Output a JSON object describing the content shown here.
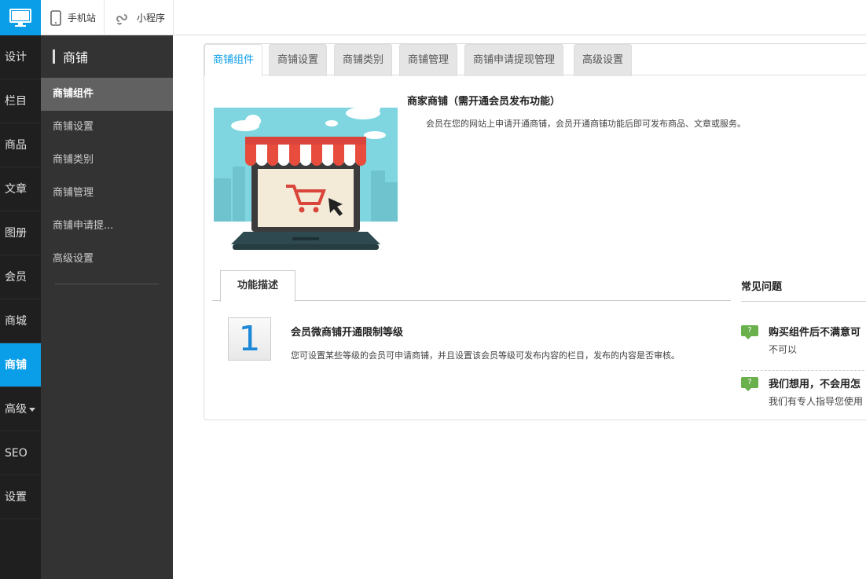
{
  "topbar": {
    "logo_icon": "desktop-monitor-icon",
    "links": [
      {
        "label": "手机站",
        "icon": "mobile-phone-icon"
      },
      {
        "label": "小程序",
        "icon": "mini-program-icon"
      }
    ]
  },
  "rail": {
    "items": [
      {
        "label": "设计"
      },
      {
        "label": "栏目"
      },
      {
        "label": "商品"
      },
      {
        "label": "文章"
      },
      {
        "label": "图册"
      },
      {
        "label": "会员"
      },
      {
        "label": "商城"
      },
      {
        "label": "商铺",
        "active": true
      },
      {
        "label": "高级"
      },
      {
        "label": "SEO"
      },
      {
        "label": "设置"
      }
    ]
  },
  "subnav": {
    "title": "商铺",
    "items": [
      {
        "label": "商铺组件",
        "active": true
      },
      {
        "label": "商铺设置"
      },
      {
        "label": "商铺类别"
      },
      {
        "label": "商铺管理"
      },
      {
        "label": "商铺申请提..."
      },
      {
        "label": "高级设置"
      }
    ]
  },
  "tabs": [
    {
      "label": "商铺组件",
      "active": true
    },
    {
      "label": "商铺设置"
    },
    {
      "label": "商铺类别"
    },
    {
      "label": "商铺管理"
    },
    {
      "label": "商铺申请提现管理"
    },
    {
      "label": "高级设置"
    }
  ],
  "intro": {
    "title": "商家商铺（需开通会员发布功能）",
    "description": "会员在您的网站上申请开通商铺，会员开通商铺功能后即可发布商品、文章或服务。"
  },
  "feature": {
    "tab_label": "功能描述",
    "number": "1",
    "title": "会员微商铺开通限制等级",
    "description": "您可设置某些等级的会员可申请商铺，并且设置该会员等级可发布内容的栏目，发布的内容是否审核。"
  },
  "faq": {
    "title": "常见问题",
    "badge": "?",
    "items": [
      {
        "question": "购买组件后不满意可",
        "answer": "不可以"
      },
      {
        "question": "我们想用，不会用怎",
        "answer": "我们有专人指导您使用"
      }
    ]
  },
  "colors": {
    "accent": "#0a9ee8",
    "rail_bg": "#1f1f1f",
    "subnav_bg": "#333333",
    "faq_badge": "#6ab04c"
  }
}
